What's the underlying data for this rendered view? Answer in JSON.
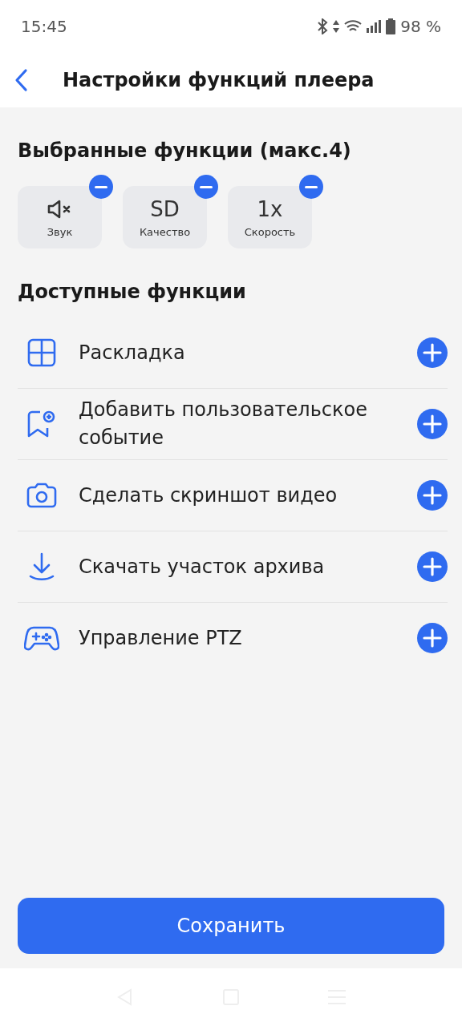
{
  "status_bar": {
    "time": "15:45",
    "battery": "98 %"
  },
  "header": {
    "title": "Настройки функций плеера"
  },
  "selected_section": {
    "title": "Выбранные функции (макс.4)",
    "items": [
      {
        "kind": "icon",
        "label": "Звук"
      },
      {
        "kind": "text",
        "symbol": "SD",
        "label": "Качество"
      },
      {
        "kind": "text",
        "symbol": "1x",
        "label": "Скорость"
      }
    ]
  },
  "available_section": {
    "title": "Доступные функции",
    "items": [
      {
        "label": "Раскладка"
      },
      {
        "label": "Добавить пользовательское событие"
      },
      {
        "label": "Сделать скриншот видео"
      },
      {
        "label": "Скачать участок архива"
      },
      {
        "label": "Управление PTZ"
      }
    ]
  },
  "save_button": "Сохранить"
}
